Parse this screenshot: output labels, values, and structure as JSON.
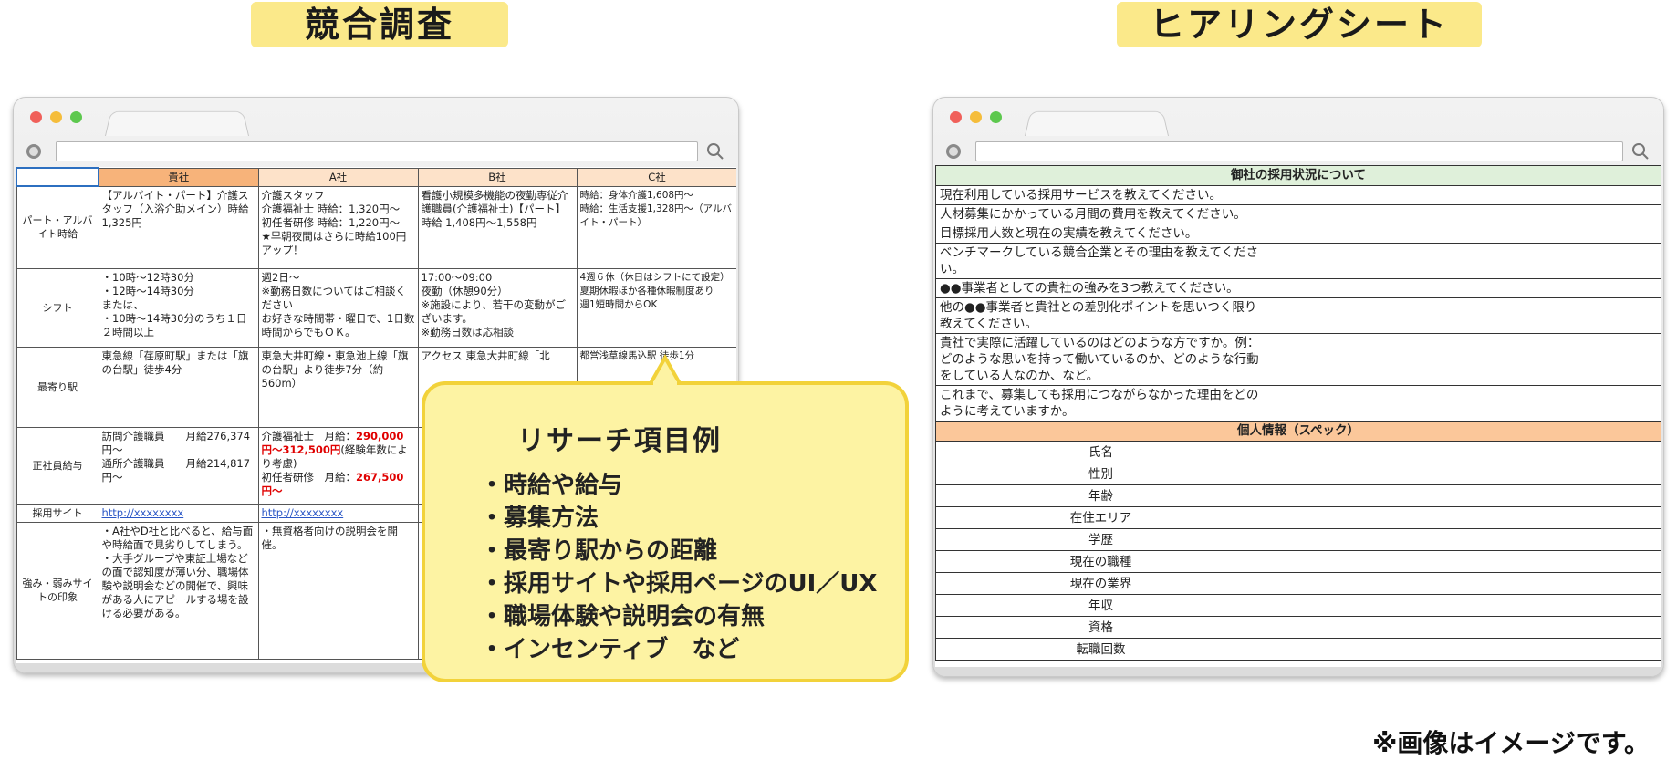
{
  "titles": {
    "left": "競合調査",
    "right": "ヒアリングシート"
  },
  "competitor_table": {
    "headers": [
      "",
      "貴社",
      "A社",
      "B社",
      "C社"
    ],
    "rows": [
      {
        "label": "パート・アルバイト時給",
        "cells": [
          "【アルバイト・パート】介護スタッフ（入浴介助メイン）時給1,325円",
          "介護スタッフ\n介護福祉士 時給：1,320円〜\n初任者研修 時給：1,220円〜\n★早朝夜間はさらに時給100円アップ！",
          "看護小規模多機能の夜勤専従介護職員(介護福祉士)【パート】\n時給 1,408円〜1,558円",
          "時給：身体介護1,608円〜\n時給：生活支援1,328円〜（アルバイト・パート）"
        ]
      },
      {
        "label": "シフト",
        "cells": [
          "・10時〜12時30分\n・12時〜14時30分\nまたは、\n・10時〜14時30分のうち１日２時間以上",
          "週2日〜\n※勤務日数についてはご相談ください\nお好きな時間帯・曜日で、1日数時間からでもＯＫ。",
          "17:00〜09:00\n夜勤（休憩90分）\n※施設により、若干の変動がございます。\n※勤務日数は応相談",
          "4週６休（休日はシフトにて設定）\n夏期休暇ほか各種休暇制度あり\n週1短時間からOK"
        ]
      },
      {
        "label": "最寄り駅",
        "cells": [
          "東急線「荏原町駅」または「旗の台駅」徒歩4分",
          "東急大井町線・東急池上線「旗の台駅」より徒歩7分（約560m）",
          "アクセス 東急大井町線「北",
          "都営浅草線馬込駅 徒歩1分"
        ]
      },
      {
        "label": "正社員給与",
        "cells": [
          "訪問介護職員　　月給276,374円〜\n通所介護職員　　月給214,817円〜",
          "",
          "",
          ""
        ],
        "a_salary": {
          "line1_prefix": "介護福祉士　月給：",
          "line1_red": "290,000円〜312,500円",
          "line1_suffix": "(経験年数により考慮)",
          "line2_prefix": "初任者研修　月給：",
          "line2_red": "267,500円〜"
        }
      },
      {
        "label": "採用サイト",
        "cells": [
          "http://xxxxxxxx",
          "http://xxxxxxxx",
          "",
          ""
        ]
      },
      {
        "label": "強み・弱みサイトの印象",
        "cells": [
          "・A社やD社と比べると、給与面や時給面で見劣りしてしまう。\n・大手グループや東証上場などの面で認知度が薄い分、職場体験や説明会などの開催で、興味がある人にアピールする場を設ける必要がある。",
          "・無資格者向けの説明会を開催。",
          "",
          ""
        ]
      }
    ]
  },
  "hearing_sheet": {
    "section1_title": "御社の採用状況について",
    "questions": [
      "現在利用している採用サービスを教えてください。",
      "人材募集にかかっている月間の費用を教えてください。",
      "目標採用人数と現在の実績を教えてください。",
      "ベンチマークしている競合企業とその理由を教えてください。",
      "●●事業者としての貴社の強みを3つ教えてください。",
      "他の●●事業者と貴社との差別化ポイントを思いつく限り教えてください。",
      "貴社で実際に活躍しているのはどのような方ですか。例：どのような思いを持って働いているのか、どのような行動をしている人なのか、など。",
      "これまで、募集しても採用につながらなかった理由をどのように考えていますか。"
    ],
    "section2_title": "個人情報（スペック）",
    "personal_fields": [
      "氏名",
      "性別",
      "年齢",
      "在住エリア",
      "学歴",
      "現在の職種",
      "現在の業界",
      "年収",
      "資格",
      "転職回数"
    ]
  },
  "callout": {
    "title": "リサーチ項目例",
    "items": [
      "・時給や給与",
      "・募集方法",
      "・最寄り駅からの距離",
      "・採用サイトや採用ページのUI／UX",
      "・職場体験や説明会の有無",
      "・インセンティブ　など"
    ]
  },
  "footnote": "※画像はイメージです。",
  "colors": {
    "title_badge": "#fbe98a",
    "callout_bg": "#fdf3a3",
    "callout_border": "#f2d23a",
    "ours_header": "#f7b37a",
    "section1_bg": "#dff0da",
    "section2_bg": "#fbc79a"
  }
}
